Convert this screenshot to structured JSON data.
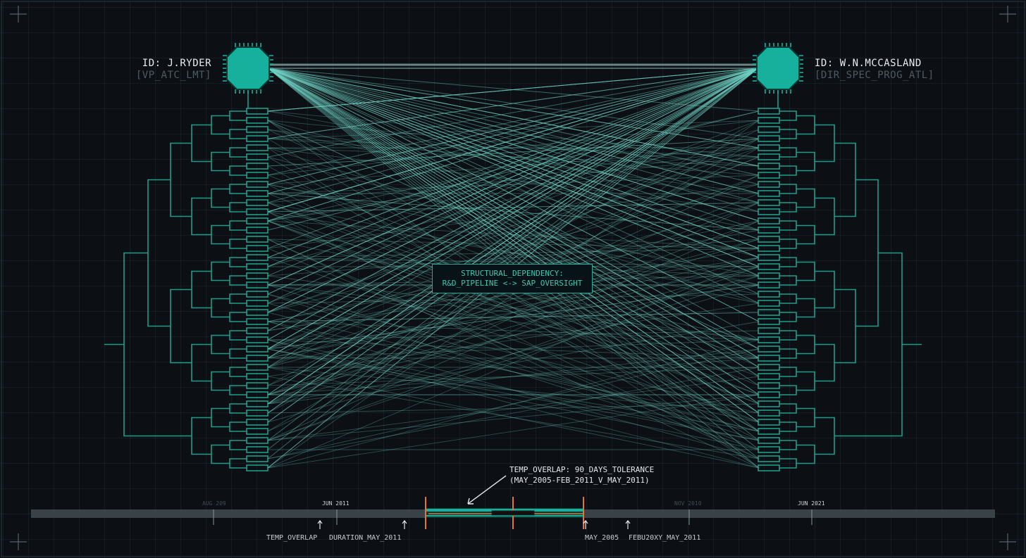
{
  "nodes": {
    "left": {
      "id": "ID: J.RYDER",
      "role": "[VP_ATC_LMT]"
    },
    "right": {
      "id": "ID: W.N.MCCASLAND",
      "role": "[DIR_SPEC_PROG_ATL]"
    }
  },
  "center_label": {
    "line1": "STRUCTURAL_DEPENDENCY:",
    "line2": "R&D_PIPELINE <-> SAP_OVERSIGHT"
  },
  "overlap_note": {
    "line1": "TEMP_OVERLAP: 90_DAYS_TOLERANCE",
    "line2": "(MAY_2005-FEB_2011_V_MAY_2011)"
  },
  "timeline": {
    "ticks": [
      "AUG 209",
      "JUN 2011",
      "NOV 2010",
      "JUN 2021"
    ],
    "markers": [
      "TEMP_OVERLAP",
      "DURATION_MAY_2011",
      "MAY_2005",
      "FEBU20XY_MAY_2011"
    ]
  },
  "colors": {
    "accent": "#17b09c",
    "line": "#6fd1c3",
    "tree": "#1e9c8a",
    "timeline_bar": "#3a4248",
    "highlight": "#e8733a"
  }
}
